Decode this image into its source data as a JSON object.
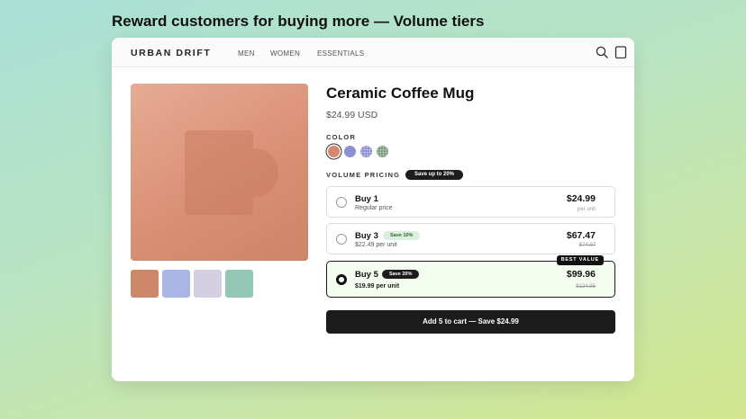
{
  "headline": "Reward customers for buying more — Volume tiers",
  "nav": {
    "brand": "URBAN DRIFT",
    "links": [
      "MEN",
      "WOMEN",
      "ESSENTIALS"
    ],
    "icons": [
      "search-icon",
      "bag-icon"
    ]
  },
  "product": {
    "title": "Ceramic Coffee Mug",
    "price": "$24.99 USD",
    "color_label": "COLOR",
    "swatches": [
      "#d4876a",
      "#8e8fd2",
      "#8e8fd2",
      "#7e9f85"
    ],
    "selected_swatch": 0,
    "thumbnails": [
      "#cd8869",
      "#a9b6e6",
      "#d4cfe1",
      "#92c8b5"
    ]
  },
  "volume": {
    "label": "VOLUME PRICING",
    "save_pill": "Save up to 20%",
    "tiers": [
      {
        "name": "Buy 1",
        "sub": "Regular price",
        "price": "$24.99",
        "note": "per unit"
      },
      {
        "name": "Buy 3",
        "badge": "Save 10%",
        "sub": "$22.49 per unit",
        "price": "$67.47",
        "old": "$74.97"
      },
      {
        "name": "Buy 5",
        "badge": "Save 20%",
        "sub": "$19.99 per unit",
        "price": "$99.96",
        "old": "$124.95",
        "best": "BEST VALUE",
        "selected": true
      }
    ]
  },
  "cart_button": "Add 5 to cart — Save $24.99"
}
